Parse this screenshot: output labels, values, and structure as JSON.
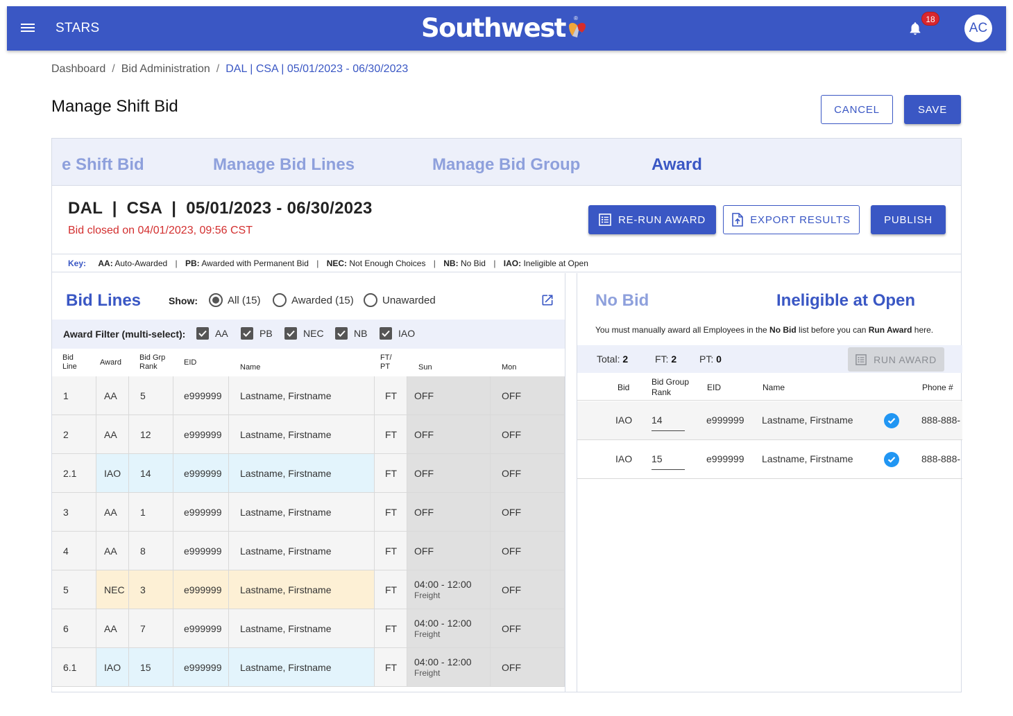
{
  "app": {
    "name": "STARS",
    "brand": "Southwest",
    "brand_color": "#3a57c4",
    "notifications_count": "18",
    "user_initials": "AC"
  },
  "breadcrumb": {
    "items": [
      "Dashboard",
      "Bid Administration"
    ],
    "current": "DAL | CSA | 05/01/2023 - 06/30/2023"
  },
  "page": {
    "title": "Manage Shift Bid",
    "cancel_label": "CANCEL",
    "save_label": "SAVE"
  },
  "tabs": [
    {
      "label": "e Shift Bid",
      "active": false
    },
    {
      "label": "Manage Bid Lines",
      "active": false
    },
    {
      "label": "Manage Bid Group",
      "active": false
    },
    {
      "label": "Award",
      "active": true
    }
  ],
  "bid": {
    "title": "DAL  |  CSA  |  05/01/2023 - 06/30/2023",
    "closed": "Bid closed on 04/01/2023, 09:56 CST",
    "rerun_label": "RE-RUN AWARD",
    "export_label": "EXPORT RESULTS",
    "publish_label": "PUBLISH"
  },
  "key": {
    "label": "Key:",
    "items": [
      {
        "code": "AA:",
        "desc": "Auto-Awarded"
      },
      {
        "code": "PB:",
        "desc": "Awarded with Permanent Bid"
      },
      {
        "code": "NEC:",
        "desc": "Not Enough Choices"
      },
      {
        "code": "NB:",
        "desc": "No Bid"
      },
      {
        "code": "IAO:",
        "desc": "Ineligible at Open"
      }
    ]
  },
  "bid_lines": {
    "title": "Bid Lines",
    "show_label": "Show:",
    "radios": [
      {
        "label": "All (15)",
        "selected": true
      },
      {
        "label": "Awarded (15)",
        "selected": false
      },
      {
        "label": "Unawarded",
        "selected": false
      }
    ],
    "filter_label": "Award Filter (multi-select):",
    "filters": [
      "AA",
      "PB",
      "NEC",
      "NB",
      "IAO"
    ],
    "columns": {
      "bid_line": "Bid\nLine",
      "award": "Award",
      "rank": "Bid Grp\nRank",
      "eid": "EID",
      "name": "Name",
      "ftpt": "FT/\nPT",
      "sun": "Sun",
      "mon": "Mon"
    },
    "rows": [
      {
        "line": "1",
        "award": "AA",
        "rank": "5",
        "eid": "e999999",
        "name": "Lastname, Firstname",
        "ftpt": "FT",
        "sun": "OFF",
        "sun_sub": "",
        "mon": "OFF",
        "type": "aa"
      },
      {
        "line": "2",
        "award": "AA",
        "rank": "12",
        "eid": "e999999",
        "name": "Lastname, Firstname",
        "ftpt": "FT",
        "sun": "OFF",
        "sun_sub": "",
        "mon": "OFF",
        "type": "aa"
      },
      {
        "line": "2.1",
        "award": "IAO",
        "rank": "14",
        "eid": "e999999",
        "name": "Lastname, Firstname",
        "ftpt": "FT",
        "sun": "OFF",
        "sun_sub": "",
        "mon": "OFF",
        "type": "iao"
      },
      {
        "line": "3",
        "award": "AA",
        "rank": "1",
        "eid": "e999999",
        "name": "Lastname, Firstname",
        "ftpt": "FT",
        "sun": "OFF",
        "sun_sub": "",
        "mon": "OFF",
        "type": "aa"
      },
      {
        "line": "4",
        "award": "AA",
        "rank": "8",
        "eid": "e999999",
        "name": "Lastname, Firstname",
        "ftpt": "FT",
        "sun": "OFF",
        "sun_sub": "",
        "mon": "OFF",
        "type": "aa"
      },
      {
        "line": "5",
        "award": "NEC",
        "rank": "3",
        "eid": "e999999",
        "name": "Lastname, Firstname",
        "ftpt": "FT",
        "sun": "04:00 - 12:00",
        "sun_sub": "Freight",
        "mon": "OFF",
        "type": "nec"
      },
      {
        "line": "6",
        "award": "AA",
        "rank": "7",
        "eid": "e999999",
        "name": "Lastname, Firstname",
        "ftpt": "FT",
        "sun": "04:00 - 12:00",
        "sun_sub": "Freight",
        "mon": "OFF",
        "type": "aa"
      },
      {
        "line": "6.1",
        "award": "IAO",
        "rank": "15",
        "eid": "e999999",
        "name": "Lastname, Firstname",
        "ftpt": "FT",
        "sun": "04:00 - 12:00",
        "sun_sub": "Freight",
        "mon": "OFF",
        "type": "iao"
      }
    ]
  },
  "no_bid": {
    "tab_no_bid": "No Bid",
    "tab_iao": "Ineligible at Open",
    "note_prefix": "You must manually award all Employees in the ",
    "note_bold1": "No Bid",
    "note_mid": " list before you can ",
    "note_bold2": "Run Award",
    "note_suffix": " here.",
    "total_label": "Total:",
    "total": "2",
    "ft_label": "FT:",
    "ft": "2",
    "pt_label": "PT:",
    "pt": "0",
    "run_award_label": "RUN AWARD",
    "columns": {
      "bid": "Bid",
      "rank": "Bid Group\nRank",
      "eid": "EID",
      "name": "Name",
      "phone": "Phone #"
    },
    "rows": [
      {
        "bid": "IAO",
        "rank": "14",
        "eid": "e999999",
        "name": "Lastname, Firstname",
        "verified": true,
        "phone": "888-888-"
      },
      {
        "bid": "IAO",
        "rank": "15",
        "eid": "e999999",
        "name": "Lastname, Firstname",
        "verified": true,
        "phone": "888-888-"
      }
    ]
  }
}
